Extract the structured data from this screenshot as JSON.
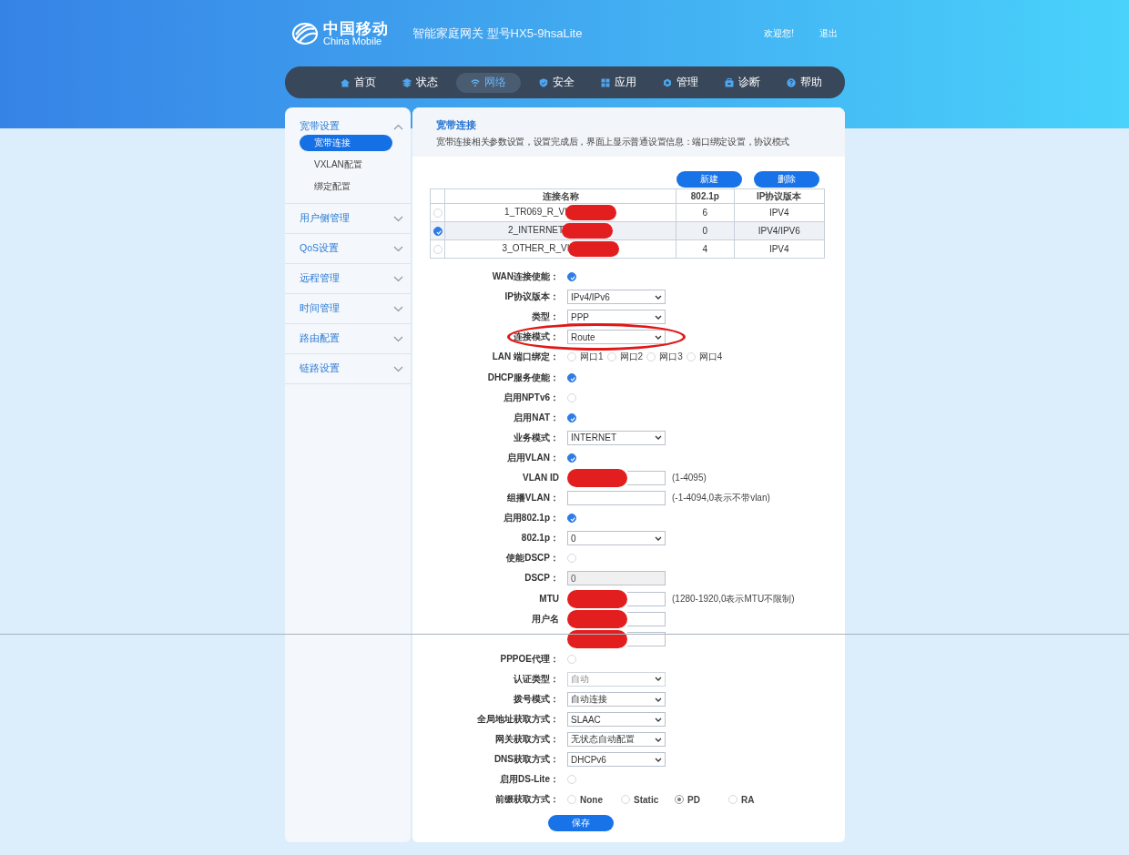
{
  "header": {
    "logo_cn": "中国移动",
    "logo_en": "China Mobile",
    "title": "智能家庭网关 型号HX5-9hsaLite",
    "welcome": "欢迎您!",
    "logout": "退出"
  },
  "nav": [
    {
      "label": "首页",
      "selected": false
    },
    {
      "label": "状态",
      "selected": false
    },
    {
      "label": "网络",
      "selected": true
    },
    {
      "label": "安全",
      "selected": false
    },
    {
      "label": "应用",
      "selected": false
    },
    {
      "label": "管理",
      "selected": false
    },
    {
      "label": "诊断",
      "selected": false
    },
    {
      "label": "帮助",
      "selected": false
    }
  ],
  "sidebar": [
    {
      "label": "宽带设置",
      "expanded": true,
      "children": [
        {
          "label": "宽带连接",
          "selected": true
        },
        {
          "label": "VXLAN配置",
          "selected": false
        },
        {
          "label": "绑定配置",
          "selected": false
        }
      ]
    },
    {
      "label": "用户侧管理",
      "expanded": false
    },
    {
      "label": "QoS设置",
      "expanded": false
    },
    {
      "label": "远程管理",
      "expanded": false
    },
    {
      "label": "时间管理",
      "expanded": false
    },
    {
      "label": "路由配置",
      "expanded": false
    },
    {
      "label": "链路设置",
      "expanded": false
    }
  ],
  "panel": {
    "title": "宽带连接",
    "description": "宽带连接相关参数设置，设置完成后，界面上显示普通设置信息：端口绑定设置，协议模式"
  },
  "buttons": [
    "新建",
    "删除"
  ],
  "table": {
    "columns": [
      "连接名称",
      "802.1p",
      "IP协议版本"
    ],
    "rows": [
      {
        "selected": false,
        "name": "1_TR069_R_VI",
        "p": "6",
        "ip": "IPV4",
        "redacted": true
      },
      {
        "selected": true,
        "name": "2_INTERNET",
        "p": "0",
        "ip": "IPV4/IPV6",
        "redacted": true
      },
      {
        "selected": false,
        "name": "3_OTHER_R_VI",
        "p": "4",
        "ip": "IPV4",
        "redacted": true
      }
    ]
  },
  "form": [
    {
      "kind": "check",
      "label": "WAN连接使能：",
      "checked": true
    },
    {
      "kind": "select",
      "label": "IP协议版本：",
      "value": "IPv4/IPv6",
      "disabled": false
    },
    {
      "kind": "select",
      "label": "类型：",
      "value": "PPP",
      "disabled": false
    },
    {
      "kind": "select",
      "label": "连接模式：",
      "value": "Route",
      "disabled": false,
      "circled": true
    },
    {
      "kind": "radios",
      "label": "LAN 端口绑定：",
      "options": [
        {
          "label": "网口1",
          "checked": false
        },
        {
          "label": "网口2",
          "checked": false
        },
        {
          "label": "网口3",
          "checked": false
        },
        {
          "label": "网口4",
          "checked": false
        }
      ]
    },
    {
      "kind": "check",
      "label": "DHCP服务使能：",
      "checked": true
    },
    {
      "kind": "check",
      "label": "启用NPTv6：",
      "checked": false
    },
    {
      "kind": "check",
      "label": "启用NAT：",
      "checked": true
    },
    {
      "kind": "select",
      "label": "业务模式：",
      "value": "INTERNET",
      "disabled": false
    },
    {
      "kind": "check",
      "label": "启用VLAN：",
      "checked": true
    },
    {
      "kind": "text",
      "label": "VLAN ID",
      "hint": "(1-4095)",
      "disabled": false,
      "redacted": true
    },
    {
      "kind": "text",
      "label": "组播VLAN：",
      "hint": "(-1-4094,0表示不带vlan)",
      "disabled": false
    },
    {
      "kind": "check",
      "label": "启用802.1p：",
      "checked": true
    },
    {
      "kind": "select",
      "label": "802.1p：",
      "value": "0",
      "disabled": false
    },
    {
      "kind": "check",
      "label": "使能DSCP：",
      "checked": false
    },
    {
      "kind": "text",
      "label": "DSCP：",
      "value": "0",
      "disabled": true
    },
    {
      "kind": "text",
      "label": "MTU",
      "hint": "(1280-1920,0表示MTU不限制)",
      "disabled": false,
      "redacted": true
    },
    {
      "kind": "text",
      "label": "用户名",
      "disabled": false,
      "redacted": true
    },
    {
      "kind": "text",
      "disabled": false,
      "redacted": true
    },
    {
      "kind": "check",
      "label": "PPPOE代理：",
      "checked": false
    },
    {
      "kind": "select",
      "label": "认证类型：",
      "value": "自动",
      "disabled": true
    },
    {
      "kind": "select",
      "label": "拨号模式：",
      "value": "自动连接",
      "disabled": false
    },
    {
      "kind": "select",
      "label": "全局地址获取方式：",
      "value": "SLAAC",
      "disabled": false
    },
    {
      "kind": "select",
      "label": "网关获取方式：",
      "value": "无状态自动配置",
      "disabled": false
    },
    {
      "kind": "select",
      "label": "DNS获取方式：",
      "value": "DHCPv6",
      "disabled": false
    },
    {
      "kind": "check",
      "label": "启用DS-Lite：",
      "checked": false
    },
    {
      "kind": "radios",
      "wide": true,
      "label": "前缀获取方式：",
      "options": [
        {
          "label": "None",
          "checked": false
        },
        {
          "label": "Static",
          "checked": false
        },
        {
          "label": "PD",
          "checked": true
        },
        {
          "label": "RA",
          "checked": false
        }
      ]
    }
  ],
  "save": "保存"
}
